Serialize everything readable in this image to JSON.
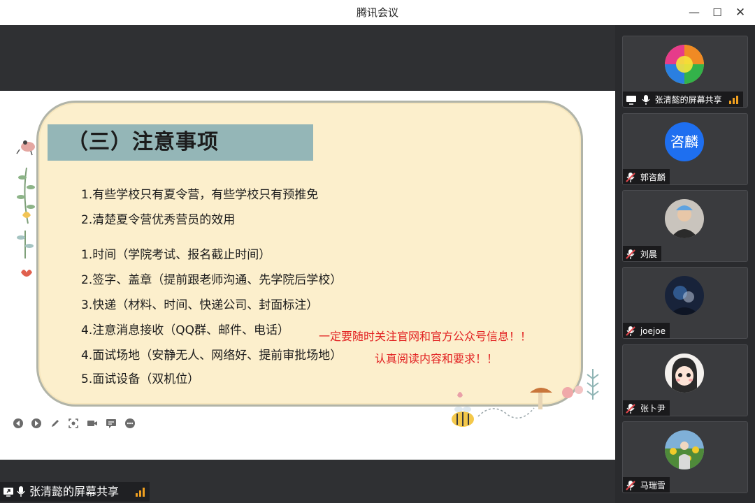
{
  "window": {
    "title": "腾讯会议"
  },
  "slide": {
    "heading": "（三）注意事项",
    "lines": [
      "1.有些学校只有夏令营，有些学校只有预推免",
      "2.清楚夏令营优秀营员的效用",
      "1.时间（学院考试、报名截止时间）",
      "2.签字、盖章（提前跟老师沟通、先学院后学校）",
      "3.快递（材料、时间、快递公司、封面标注）",
      "4.注意消息接收（QQ群、邮件、电话）",
      "4.面试场地（安静无人、网络好、提前审批场地）",
      "5.面试设备（双机位）"
    ],
    "notes": [
      "一定要随时关注官网和官方公众号信息！！",
      "认真阅读内容和要求！！"
    ]
  },
  "share_label": "张清懿的屏幕共享",
  "participants": [
    {
      "name": "张清懿的屏幕共享",
      "avatar": "rainbow-avatar",
      "mic": "on",
      "sharing": true
    },
    {
      "name": "郭咨麟",
      "avatar": "咨麟",
      "avatar_color": "#1e6ff0",
      "mic": "muted"
    },
    {
      "name": "刘晨",
      "avatar": "photo-avatar",
      "mic": "muted"
    },
    {
      "name": "joejoe",
      "avatar": "photo-avatar",
      "mic": "muted"
    },
    {
      "name": "张卜尹",
      "avatar": "cartoon-avatar",
      "mic": "muted"
    },
    {
      "name": "马瑞雪",
      "avatar": "sunflower-avatar",
      "mic": "muted"
    }
  ],
  "colors": {
    "accent_red": "#e22222",
    "heading_bar": "#94b6b7",
    "card": "#fcefcc",
    "muted_red": "#e5484d"
  }
}
